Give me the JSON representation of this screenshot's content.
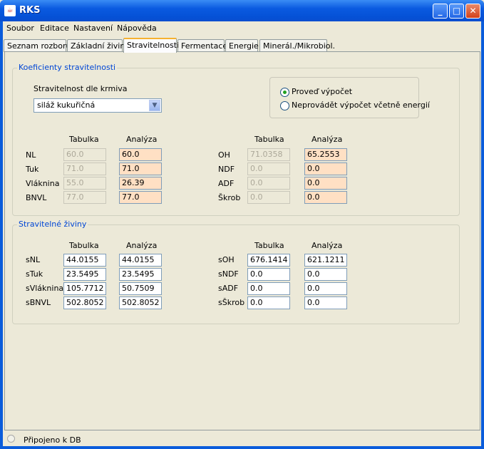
{
  "window": {
    "title": "RKS"
  },
  "menu": [
    "Soubor",
    "Editace",
    "Nastavení",
    "Nápověda"
  ],
  "tabs": [
    "Seznam rozborů",
    "Základní živiny",
    "Stravitelnosti",
    "Fermentace",
    "Energie",
    "Minerál./Mikrobiol."
  ],
  "active_tab": "Stravitelnosti",
  "koef": {
    "title": "Koeficienty stravitelnosti",
    "krmivo_label": "Stravitelnost dle krmiva",
    "krmivo_value": "siláž kukuřičná",
    "radio1": "Proveď výpočet",
    "radio2": "Neprovádět výpočet včetně energií",
    "col_tab": "Tabulka",
    "col_an": "Analýza",
    "left": [
      {
        "label": "NL",
        "tab": "60.0",
        "an": "60.0"
      },
      {
        "label": "Tuk",
        "tab": "71.0",
        "an": "71.0"
      },
      {
        "label": "Vláknina",
        "tab": "55.0",
        "an": "26.39"
      },
      {
        "label": "BNVL",
        "tab": "77.0",
        "an": "77.0"
      }
    ],
    "right": [
      {
        "label": "OH",
        "tab": "71.0358",
        "an": "65.2553"
      },
      {
        "label": "NDF",
        "tab": "0.0",
        "an": "0.0"
      },
      {
        "label": "ADF",
        "tab": "0.0",
        "an": "0.0"
      },
      {
        "label": "Škrob",
        "tab": "0.0",
        "an": "0.0"
      }
    ]
  },
  "straw": {
    "title": "Stravitelné živiny",
    "col_tab": "Tabulka",
    "col_an": "Analýza",
    "left": [
      {
        "label": "sNL",
        "tab": "44.0155",
        "an": "44.0155"
      },
      {
        "label": "sTuk",
        "tab": "23.5495",
        "an": "23.5495"
      },
      {
        "label": "sVláknina",
        "tab": "105.7712",
        "an": "50.7509"
      },
      {
        "label": "sBNVL",
        "tab": "502.8052",
        "an": "502.8052"
      }
    ],
    "right": [
      {
        "label": "sOH",
        "tab": "676.1414",
        "an": "621.1211"
      },
      {
        "label": "sNDF",
        "tab": "0.0",
        "an": "0.0"
      },
      {
        "label": "sADF",
        "tab": "0.0",
        "an": "0.0"
      },
      {
        "label": "sŠkrob",
        "tab": "0.0",
        "an": "0.0"
      }
    ]
  },
  "status": "Připojeno k DB"
}
